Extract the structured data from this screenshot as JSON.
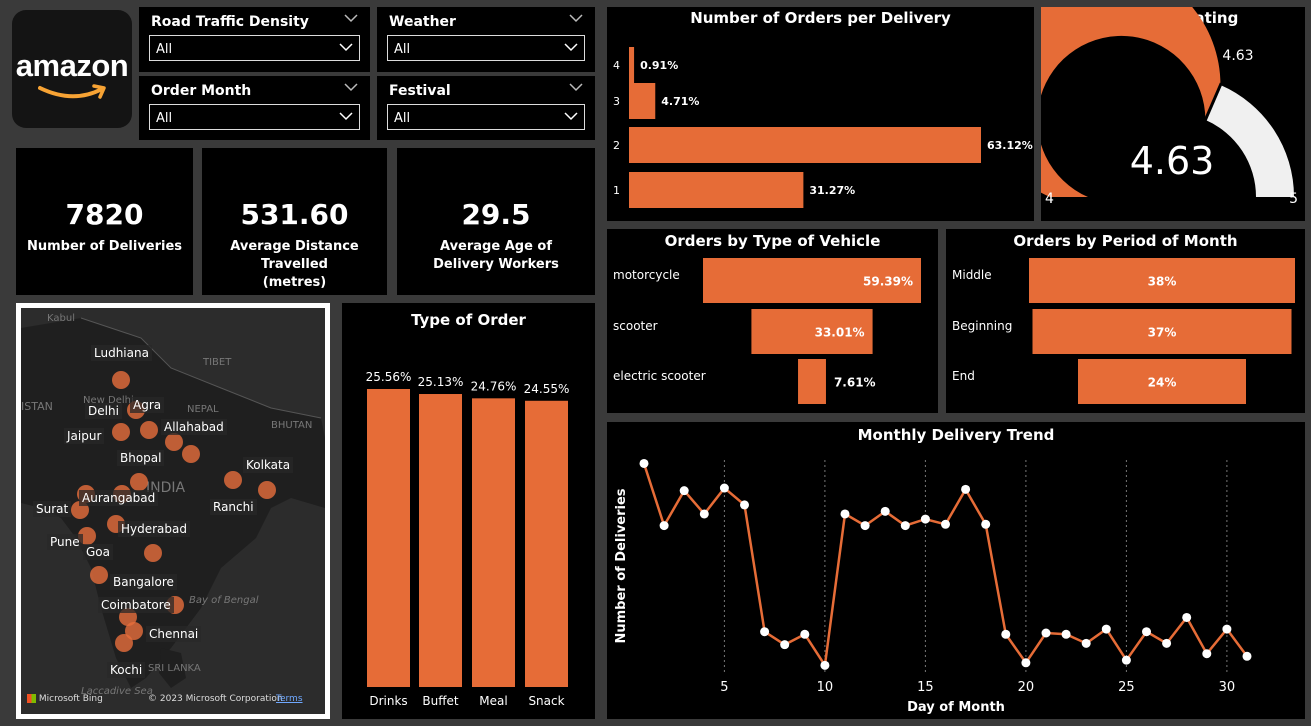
{
  "logo": {
    "text": "amazon"
  },
  "slicers": [
    {
      "title": "Road Traffic Density",
      "value": "All"
    },
    {
      "title": "Weather",
      "value": "All"
    },
    {
      "title": "Order Month",
      "value": "All"
    },
    {
      "title": "Festival",
      "value": "All"
    }
  ],
  "kpis": [
    {
      "value": "7820",
      "label": "Number of Deliveries"
    },
    {
      "value": "531.60",
      "label": "Average Distance Travelled (metres)"
    },
    {
      "value": "29.5",
      "label": "Average Age of Delivery Workers"
    }
  ],
  "map": {
    "cities": [
      "Ludhiana",
      "Delhi",
      "Agra",
      "Jaipur",
      "Allahabad",
      "Bhopal",
      "Kolkata",
      "Aurangabad",
      "Ranchi",
      "Surat",
      "Hyderabad",
      "Pune",
      "Goa",
      "Bangalore",
      "Coimbatore",
      "Chennai",
      "Kochi"
    ],
    "background_labels": [
      "Kabul",
      "TIBET",
      "ISTAN",
      "New Delhi",
      "NEPAL",
      "BHUTAN",
      "INDIA",
      "Bay of Bengal",
      "SRI LANKA",
      "Laccadive Sea"
    ],
    "attribution": "Microsoft Bing",
    "copyright": "© 2023 Microsoft Corporation",
    "terms": "Terms"
  },
  "chart_data": [
    {
      "id": "orders_per_delivery",
      "type": "bar",
      "orientation": "horizontal",
      "title": "Number of Orders per Delivery",
      "categories": [
        "4",
        "3",
        "2",
        "1"
      ],
      "values": [
        0.91,
        4.71,
        63.12,
        31.27
      ],
      "labels": [
        "0.91%",
        "4.71%",
        "63.12%",
        "31.27%"
      ],
      "color": "#E66C37"
    },
    {
      "id": "delivery_rating",
      "type": "gauge",
      "title": "Delivery Rating",
      "value": 4.63,
      "value_label": "4.63",
      "min": 4,
      "max": 5,
      "min_label": "4",
      "max_label": "5",
      "target_label": "4.63",
      "color": "#E66C37"
    },
    {
      "id": "orders_by_vehicle",
      "type": "bar",
      "orientation": "funnel",
      "title": "Orders by Type of Vehicle",
      "categories": [
        "motorcycle",
        "scooter",
        "electric scooter"
      ],
      "values": [
        59.39,
        33.01,
        7.61
      ],
      "labels": [
        "59.39%",
        "33.01%",
        "7.61%"
      ],
      "color": "#E66C37"
    },
    {
      "id": "orders_by_period",
      "type": "bar",
      "orientation": "funnel",
      "title": "Orders by Period of Month",
      "categories": [
        "Middle",
        "Beginning",
        "End"
      ],
      "values": [
        38,
        37,
        24
      ],
      "labels": [
        "38%",
        "37%",
        "24%"
      ],
      "color": "#E66C37"
    },
    {
      "id": "type_of_order",
      "type": "bar",
      "title": "Type of Order",
      "categories": [
        "Drinks",
        "Buffet",
        "Meal",
        "Snack"
      ],
      "values": [
        25.56,
        25.13,
        24.76,
        24.55
      ],
      "labels": [
        "25.56%",
        "25.13%",
        "24.76%",
        "24.55%"
      ],
      "color": "#E66C37"
    },
    {
      "id": "monthly_trend",
      "type": "line",
      "title": "Monthly Delivery Trend",
      "xlabel": "Day of Month",
      "ylabel": "Number of Deliveries",
      "x": [
        1,
        2,
        3,
        4,
        5,
        6,
        7,
        8,
        9,
        10,
        11,
        12,
        13,
        14,
        15,
        16,
        17,
        18,
        19,
        20,
        21,
        22,
        23,
        24,
        25,
        26,
        27,
        28,
        29,
        30,
        31
      ],
      "y": [
        315,
        267,
        294,
        276,
        296,
        283,
        185,
        175,
        183,
        159,
        276,
        267,
        278,
        267,
        272,
        268,
        295,
        268,
        183,
        161,
        184,
        183,
        176,
        187,
        163,
        185,
        176,
        196,
        168,
        187,
        166
      ],
      "xticks": [
        5,
        10,
        15,
        20,
        25,
        30
      ],
      "color": "#E66C37"
    }
  ]
}
